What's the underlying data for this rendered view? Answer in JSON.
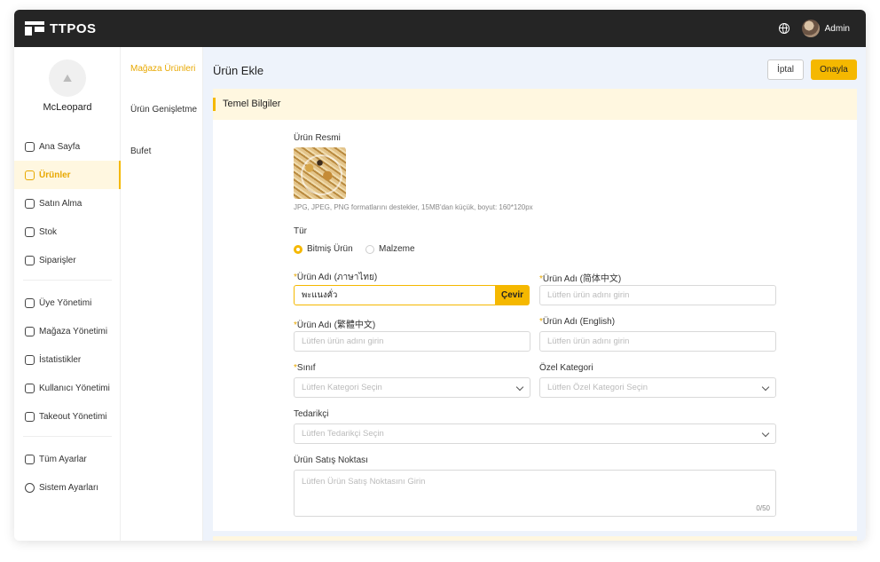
{
  "app": {
    "logo_text": "TTPOS",
    "user_name": "Admin"
  },
  "sidebar": {
    "store_name": "McLeopard",
    "items": [
      {
        "label": "Ana Sayfa",
        "icon": "chart-icon"
      },
      {
        "label": "Ürünler",
        "icon": "cube-icon",
        "active": true
      },
      {
        "label": "Satın Alma",
        "icon": "cart-icon"
      },
      {
        "label": "Stok",
        "icon": "box-icon"
      },
      {
        "label": "Siparişler",
        "icon": "clipboard-icon"
      },
      {
        "label": "Üye Yönetimi",
        "icon": "member-icon"
      },
      {
        "label": "Mağaza Yönetimi",
        "icon": "store-icon"
      },
      {
        "label": "İstatistikler",
        "icon": "stats-icon"
      },
      {
        "label": "Kullanıcı Yönetimi",
        "icon": "users-icon"
      },
      {
        "label": "Takeout Yönetimi",
        "icon": "takeout-icon"
      },
      {
        "label": "Tüm Ayarlar",
        "icon": "settings-grid-icon"
      },
      {
        "label": "Sistem Ayarları",
        "icon": "gear-icon"
      }
    ]
  },
  "subnav": {
    "items": [
      {
        "label": "Mağaza Ürünleri",
        "active": true
      },
      {
        "label": "Ürün Genişletme"
      },
      {
        "label": "Bufet"
      }
    ]
  },
  "page": {
    "title": "Ürün Ekle",
    "cancel_label": "İptal",
    "confirm_label": "Onayla",
    "section_title": "Temel Bilgiler"
  },
  "form": {
    "image_label": "Ürün Resmi",
    "image_hint": "JPG, JPEG, PNG formatlarını destekler, 15MB'dan küçük, boyut: 160*120px",
    "type_label": "Tür",
    "type_options": [
      "Bitmiş Ürün",
      "Malzeme"
    ],
    "type_selected": "Bitmiş Ürün",
    "name_th_label": "Ürün Adı (ภาษาไทย)",
    "name_th_value": "พะแนงคั่ว",
    "translate_label": "Çevir",
    "name_zh_cn_label": "Ürün Adı (简体中文)",
    "name_zh_tw_label": "Ürün Adı (繁體中文)",
    "name_en_label": "Ürün Adı (English)",
    "name_placeholder": "Lütfen ürün adını girin",
    "class_label": "Sınıf",
    "class_placeholder": "Lütfen Kategori Seçin",
    "special_label": "Özel Kategori",
    "special_placeholder": "Lütfen Özel Kategori Seçin",
    "supplier_label": "Tedarikçi",
    "supplier_placeholder": "Lütfen Tedarikçi Seçin",
    "selling_point_label": "Ürün Satış Noktası",
    "selling_point_placeholder": "Lütfen Ürün Satış Noktasını Girin",
    "selling_point_counter": "0/50"
  },
  "colors": {
    "accent": "#f5b800",
    "topbar": "#252525",
    "main_bg": "#eef3fb"
  }
}
